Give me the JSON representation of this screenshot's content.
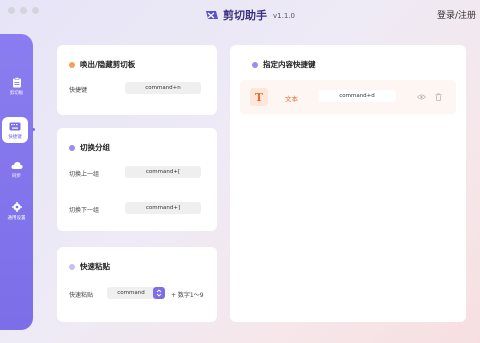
{
  "app": {
    "name": "剪切助手",
    "version": "v1.1.0",
    "login": "登录/注册"
  },
  "colors": {
    "accent": "#7b6ee8",
    "orange": "#ef6c2c",
    "dot_orange": "#f5a05a",
    "dot_purple": "#9b8cf0",
    "dot_light": "#c8bdf5"
  },
  "sidebar": {
    "items": [
      {
        "label": "剪切板",
        "icon": "clipboard-icon"
      },
      {
        "label": "快捷键",
        "icon": "keyboard-icon",
        "active": true
      },
      {
        "label": "同步",
        "icon": "cloud-icon"
      },
      {
        "label": "通用设置",
        "icon": "gear-icon"
      }
    ]
  },
  "cards": {
    "toggle": {
      "title": "唤出/隐藏剪切板",
      "rows": [
        {
          "label": "快捷键",
          "key": "command+n"
        }
      ]
    },
    "switch": {
      "title": "切换分组",
      "rows": [
        {
          "label": "切换上一组",
          "key": "command+["
        },
        {
          "label": "切换下一组",
          "key": "command+]"
        }
      ]
    },
    "paste": {
      "title": "快速粘贴",
      "label": "快速粘贴",
      "key": "command",
      "suffix": "+ 数字1～9"
    },
    "assign": {
      "title": "指定内容快捷键",
      "entries": [
        {
          "type_icon": "T",
          "type": "文本",
          "key": "command+d"
        }
      ]
    }
  }
}
